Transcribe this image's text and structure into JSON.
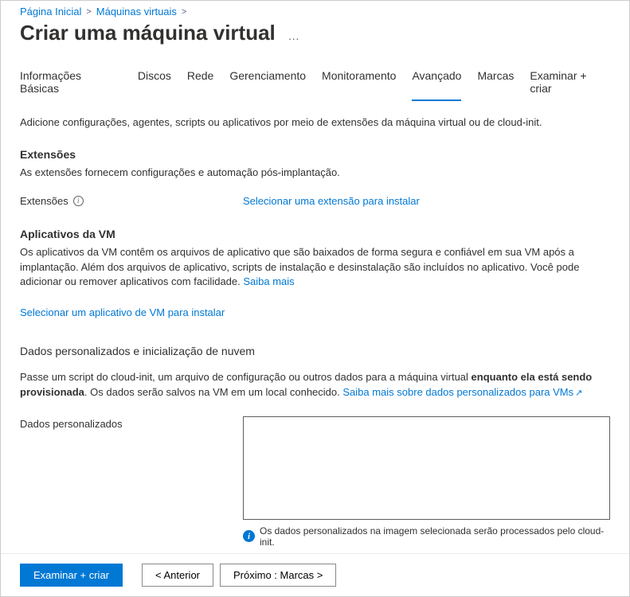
{
  "breadcrumb": {
    "home": "Página Inicial",
    "vms": "Máquinas virtuais"
  },
  "page_title": "Criar uma máquina virtual",
  "tabs": [
    {
      "label": "Informações Básicas",
      "active": false
    },
    {
      "label": "Discos",
      "active": false
    },
    {
      "label": "Rede",
      "active": false
    },
    {
      "label": "Gerenciamento",
      "active": false
    },
    {
      "label": "Monitoramento",
      "active": false
    },
    {
      "label": "Avançado",
      "active": true
    },
    {
      "label": "Marcas",
      "active": false
    },
    {
      "label": "Examinar + criar",
      "active": false
    }
  ],
  "intro": "Adicione configurações, agentes, scripts ou aplicativos por meio de extensões da máquina virtual ou de cloud-init.",
  "extensions": {
    "heading": "Extensões",
    "desc": "As extensões fornecem configurações e automação pós-implantação.",
    "field_label": "Extensões",
    "select_link": "Selecionar uma extensão para instalar"
  },
  "vm_apps": {
    "heading": "Aplicativos da VM",
    "desc_part1": "Os aplicativos da VM contêm os arquivos de aplicativo que são baixados de forma segura e confiável em sua VM após a implantação. Além dos arquivos de aplicativo, scripts de instalação e desinstalação são incluídos no aplicativo. Você pode adicionar ou remover aplicativos com facilidade. ",
    "learn_more": "Saiba mais",
    "select_link": "Selecionar um aplicativo de VM para instalar"
  },
  "custom_data": {
    "heading": "Dados personalizados e inicialização de nuvem",
    "desc_part1": "Passe um script do cloud-init, um arquivo de configuração ou outros dados para a máquina virtual ",
    "desc_bold": "enquanto ela está sendo provisionada",
    "desc_part2": ". Os dados serão salvos na VM em um local conhecido. ",
    "learn_more": "Saiba mais sobre dados personalizados para VMs",
    "field_label": "Dados personalizados",
    "note": "Os dados personalizados na imagem selecionada serão processados pelo cloud-init."
  },
  "buttons": {
    "review_create": "Examinar + criar",
    "previous": "<   Anterior",
    "next": "Próximo : Marcas   >"
  }
}
